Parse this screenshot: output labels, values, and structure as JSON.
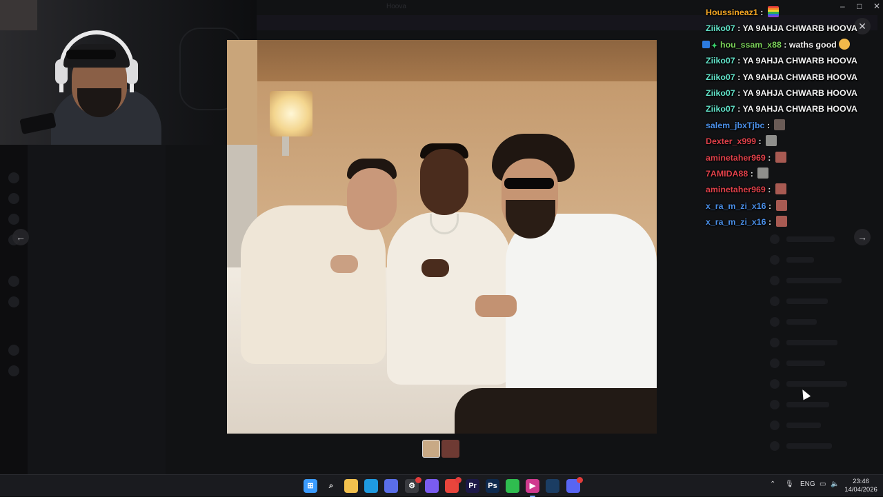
{
  "viewer": {
    "title": "Hoova",
    "close_icon": "✕",
    "prev_icon": "←",
    "next_icon": "→"
  },
  "chat": {
    "messages": [
      {
        "user": "Houssineaz1",
        "color": "#f5a623",
        "text": "",
        "emote": "flag"
      },
      {
        "user": "Ziiko07",
        "color": "#62e3c9",
        "text": "YA 9AHJA CHWARB HOOVA",
        "emote": ""
      },
      {
        "user": "hou_ssam_x88",
        "color": "#7bd35a",
        "text": "waths good",
        "emote": "face",
        "badges": true
      },
      {
        "user": "Ziiko07",
        "color": "#62e3c9",
        "text": "YA 9AHJA CHWARB HOOVA",
        "emote": ""
      },
      {
        "user": "Ziiko07",
        "color": "#62e3c9",
        "text": "YA 9AHJA CHWARB HOOVA",
        "emote": ""
      },
      {
        "user": "Ziiko07",
        "color": "#62e3c9",
        "text": "YA 9AHJA CHWARB HOOVA",
        "emote": ""
      },
      {
        "user": "Ziiko07",
        "color": "#62e3c9",
        "text": "YA 9AHJA CHWARB HOOVA",
        "emote": ""
      },
      {
        "user": "salem_jbxTjbc",
        "color": "#4a8fe8",
        "text": "",
        "emote": "pic"
      },
      {
        "user": "Dexter_x999",
        "color": "#e0414a",
        "text": "",
        "emote": "pic3"
      },
      {
        "user": "aminetaher969",
        "color": "#e0414a",
        "text": "",
        "emote": "pic2"
      },
      {
        "user": "7AMIDA88",
        "color": "#e0414a",
        "text": "",
        "emote": "pic3"
      },
      {
        "user": "aminetaher969",
        "color": "#e0414a",
        "text": "",
        "emote": "pic2"
      },
      {
        "user": "x_ra_m_zi_x16",
        "color": "#4a8fe8",
        "text": "",
        "emote": "pic2"
      },
      {
        "user": "x_ra_m_zi_x16",
        "color": "#4a8fe8",
        "text": "",
        "emote": "pic2"
      }
    ]
  },
  "taskbar": {
    "lang": "ENG",
    "time": "23:46",
    "date": "14/04/2026",
    "apps": [
      {
        "name": "windows-start-icon",
        "glyph": "⊞",
        "color": "#3b9cff"
      },
      {
        "name": "search-icon",
        "glyph": "⌕",
        "color": "#1a1b1f"
      },
      {
        "name": "file-explorer-icon",
        "glyph": "",
        "color": "#f2c14e"
      },
      {
        "name": "edge-icon",
        "glyph": "",
        "color": "#1f9ae0"
      },
      {
        "name": "store-icon",
        "glyph": "",
        "color": "#5a6ee8"
      },
      {
        "name": "settings-icon",
        "glyph": "⚙",
        "color": "#3a3b40"
      },
      {
        "name": "discord-alt-icon",
        "glyph": "",
        "color": "#7a5cf0"
      },
      {
        "name": "chrome-icon",
        "glyph": "",
        "color": "#e8453c"
      },
      {
        "name": "premiere-icon",
        "glyph": "Pr",
        "color": "#1c1848"
      },
      {
        "name": "photoshop-icon",
        "glyph": "Ps",
        "color": "#0e2a4e"
      },
      {
        "name": "whatsapp-icon",
        "glyph": "",
        "color": "#2fbd4f"
      },
      {
        "name": "media-player-icon",
        "glyph": "▶",
        "color": "#d03a8f"
      },
      {
        "name": "steam-icon",
        "glyph": "",
        "color": "#1b3d63"
      },
      {
        "name": "discord-icon",
        "glyph": "",
        "color": "#5865f2"
      }
    ]
  }
}
